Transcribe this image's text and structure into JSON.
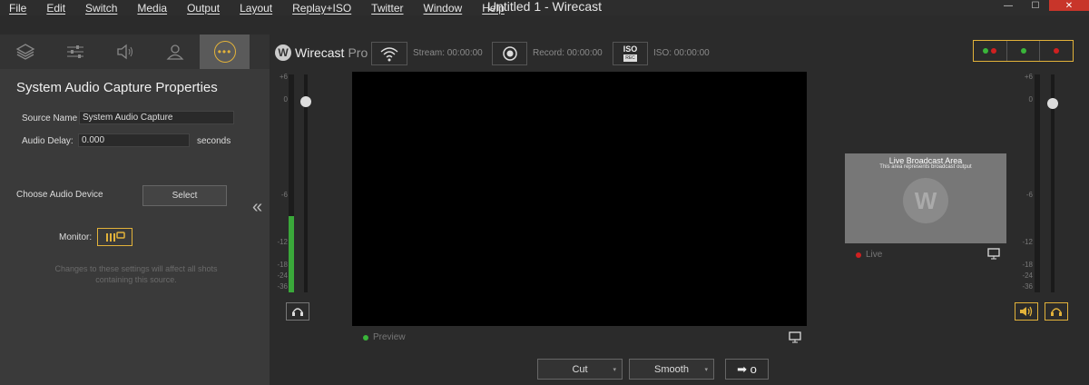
{
  "window": {
    "title": "Untitled 1 - Wirecast"
  },
  "menu": [
    "File",
    "Edit",
    "Switch",
    "Media",
    "Output",
    "Layout",
    "Replay+ISO",
    "Twitter",
    "Window",
    "Help"
  ],
  "window_controls": {
    "minimize": "—",
    "maximize": "☐",
    "close": "✕"
  },
  "tabs": [
    {
      "icon": "layers-icon"
    },
    {
      "icon": "sliders-icon"
    },
    {
      "icon": "speaker-icon"
    },
    {
      "icon": "person-icon"
    },
    {
      "icon": "more-icon",
      "active": true
    }
  ],
  "properties": {
    "title": "System Audio Capture Properties",
    "source_name_label": "Source Name",
    "source_name_value": "System Audio Capture",
    "audio_delay_label": "Audio Delay:",
    "audio_delay_value": "0.000",
    "audio_delay_unit": "seconds",
    "choose_device_label": "Choose Audio Device",
    "select_button": "Select",
    "monitor_label": "Monitor:",
    "hint": "Changes to these settings will affect all shots containing this source."
  },
  "collapse_glyph": "«",
  "toolbar": {
    "brand": "Wirecast",
    "edition": "Pro",
    "stream_label": "Stream: 00:00:00",
    "record_label": "Record: 00:00:00",
    "iso_button": "ISO",
    "iso_button_sub": "REC",
    "iso_label": "ISO: 00:00:00"
  },
  "meter_scale_left": [
    "+6",
    "0",
    "-6",
    "-12",
    "-18",
    "-24",
    "-36"
  ],
  "meter_scale_right": [
    "+6",
    "0",
    "-6",
    "-12",
    "-18",
    "-24",
    "-36"
  ],
  "meter_left_level": 0.35,
  "preview": {
    "label": "Preview"
  },
  "live": {
    "title": "Live Broadcast Area",
    "subtitle": "This area represents broadcast output",
    "label": "Live"
  },
  "transitions": {
    "cut": "Cut",
    "smooth": "Smooth",
    "go": "➡ o"
  },
  "colors": {
    "accent": "#e2b23a",
    "live_red": "#d02020",
    "preview_green": "#3ab53a"
  }
}
